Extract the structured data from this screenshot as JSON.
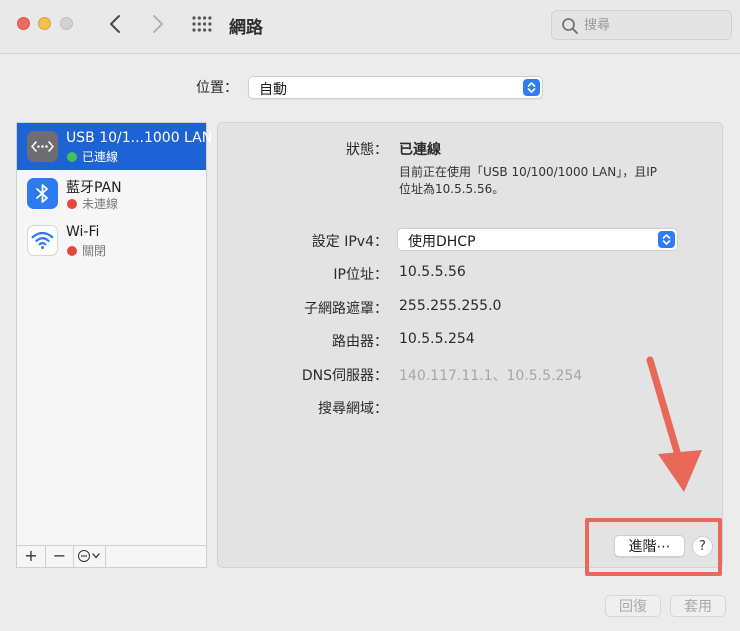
{
  "window": {
    "title": "網路",
    "search_placeholder": "搜尋"
  },
  "location": {
    "label": "位置：",
    "value": "自動"
  },
  "services": [
    {
      "name": "USB 10/1...1000 LAN",
      "status": "已連線",
      "status_color": "#3fc25a",
      "selected": true,
      "icon": "ethernet-icon"
    },
    {
      "name": "藍牙PAN",
      "status": "未連線",
      "status_color": "#e2493d",
      "selected": false,
      "icon": "bluetooth-icon"
    },
    {
      "name": "Wi-Fi",
      "status": "關閉",
      "status_color": "#e2493d",
      "selected": false,
      "icon": "wifi-icon"
    }
  ],
  "sidebar_toolbar": {
    "add": "+",
    "remove": "−"
  },
  "details": {
    "status_label": "狀態：",
    "status_value": "已連線",
    "status_desc_line1": "目前正在使用「USB 10/100/1000 LAN」，且IP",
    "status_desc_line2": "位址為10.5.5.56。",
    "ipv4_label": "設定 IPv4：",
    "ipv4_value": "使用DHCP",
    "ip_label": "IP位址：",
    "ip_value": "10.5.5.56",
    "subnet_label": "子網路遮罩：",
    "subnet_value": "255.255.255.0",
    "router_label": "路由器：",
    "router_value": "10.5.5.254",
    "dns_label": "DNS伺服器：",
    "dns_value": "140.117.11.1、10.5.5.254",
    "search_domain_label": "搜尋網域："
  },
  "buttons": {
    "advanced": "進階⋯",
    "help": "?",
    "revert": "回復",
    "apply": "套用"
  },
  "colors": {
    "accent": "#1e63d6",
    "annotation": "#e8695a"
  }
}
